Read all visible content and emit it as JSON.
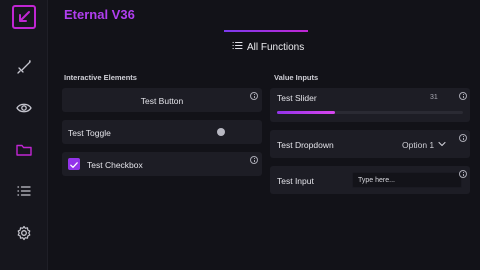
{
  "app": {
    "title": "Eternal V36"
  },
  "sidebar": {
    "items": [
      {
        "icon": "sword-icon"
      },
      {
        "icon": "eye-icon"
      },
      {
        "icon": "folder-icon",
        "active": true
      },
      {
        "icon": "list-icon"
      },
      {
        "icon": "gear-icon"
      }
    ]
  },
  "tab": {
    "label": "All Functions",
    "icon": "list-icon"
  },
  "left_section": {
    "title": "Interactive Elements",
    "button_label": "Test Button",
    "toggle_label": "Test Toggle",
    "toggle_on": false,
    "checkbox_label": "Test Checkbox",
    "checkbox_checked": true
  },
  "right_section": {
    "title": "Value Inputs",
    "slider_label": "Test Slider",
    "slider_value": "31",
    "slider_fraction": 0.31,
    "dropdown_label": "Test Dropdown",
    "dropdown_value": "Option 1",
    "input_label": "Test Input",
    "input_placeholder": "Type here..."
  },
  "colors": {
    "accent": "#b13ef0",
    "accent_pink": "#c026d3",
    "background": "#121218",
    "card": "#1d1d25"
  }
}
